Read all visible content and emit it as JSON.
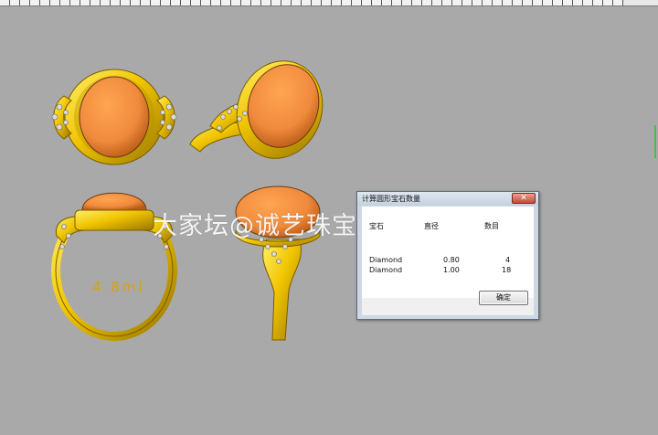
{
  "watermark": "大家坛@诚艺珠宝高级定制",
  "ring_size_label": "4.8ml",
  "dialog": {
    "title": "计算圆形宝石数量",
    "close_symbol": "✕",
    "columns": [
      "宝石",
      "直径",
      "数目"
    ],
    "rows": [
      {
        "stone": "Diamond",
        "diameter": "0.80",
        "count": "4"
      },
      {
        "stone": "Diamond",
        "diameter": "1.00",
        "count": "18"
      }
    ],
    "ok_label": "确定"
  },
  "colors": {
    "viewport_background": "#a9a9a9",
    "metal": "#f0c400",
    "stone": "#f08a3c",
    "accent_green": "#3ec43e"
  },
  "icons": {
    "close": "close-icon"
  }
}
